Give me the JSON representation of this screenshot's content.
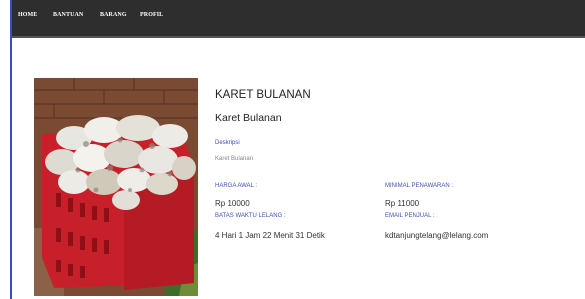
{
  "nav": {
    "items": [
      {
        "label": "HOME"
      },
      {
        "label": "BANTUAN"
      },
      {
        "label": "BARANG"
      },
      {
        "label": "PROFIL"
      }
    ]
  },
  "product": {
    "title": "KARET BULANAN",
    "subtitle": "Karet Bulanan",
    "description_label": "Deskripsi",
    "description": "Karet Bulanan",
    "harga_awal_label": "HARGA AWAL :",
    "harga_awal": "Rp 10000",
    "minimal_label": "MINIMAL PENAWARAN :",
    "minimal": "Rp 11000",
    "batas_label": "BATAS WAKTU LELANG :",
    "batas": "4 Hari 1 Jam 22 Menit 31 Detik",
    "email_label": "EMAIL PENJUAL :",
    "email": "kdtanjungtelang@lelang.com"
  },
  "colors": {
    "navbar": "#2e2e2e",
    "label_blue": "#3f4fb8",
    "crate_red": "#c8202a",
    "frame_blue": "#3a4fbf"
  }
}
